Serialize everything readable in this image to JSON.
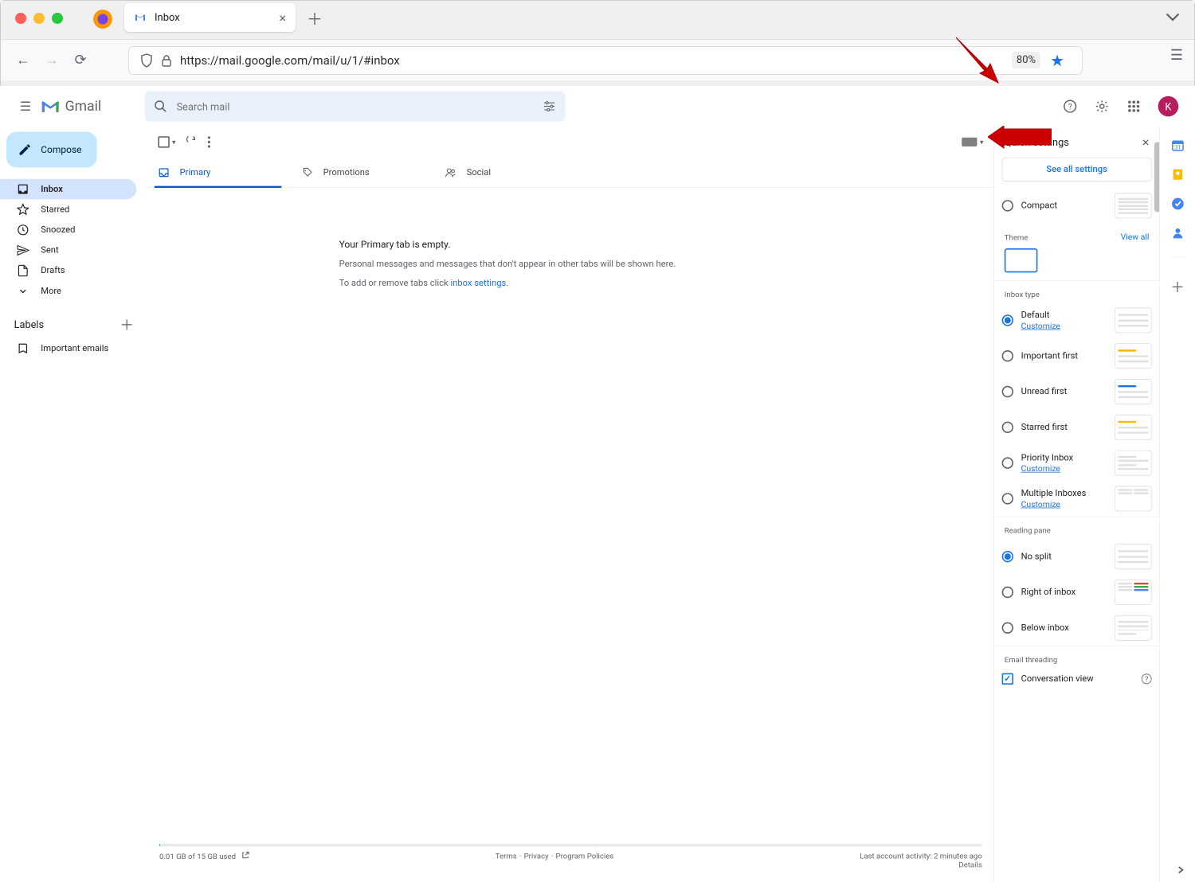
{
  "browser": {
    "tab_title": "Inbox",
    "url": "https://mail.google.com/mail/u/1/#inbox",
    "zoom": "80%"
  },
  "gmail": {
    "logo": "Gmail",
    "search_placeholder": "Search mail",
    "compose": "Compose",
    "avatar_initial": "K"
  },
  "nav": {
    "items": [
      {
        "label": "Inbox"
      },
      {
        "label": "Starred"
      },
      {
        "label": "Snoozed"
      },
      {
        "label": "Sent"
      },
      {
        "label": "Drafts"
      },
      {
        "label": "More"
      }
    ],
    "labels_header": "Labels",
    "labels": [
      {
        "label": "Important emails"
      }
    ]
  },
  "tabs": {
    "primary": "Primary",
    "promotions": "Promotions",
    "social": "Social"
  },
  "empty": {
    "title": "Your Primary tab is empty.",
    "line1": "Personal messages and messages that don't appear in other tabs will be shown here.",
    "line2_prefix": "To add or remove tabs click ",
    "line2_link": "inbox settings",
    "line2_suffix": "."
  },
  "footer": {
    "storage": "0.01 GB of 15 GB used",
    "terms": "Terms",
    "privacy": "Privacy",
    "policies": "Program Policies",
    "activity": "Last account activity: 2 minutes ago",
    "details": "Details"
  },
  "quick_settings": {
    "title": "Quick settings",
    "see_all": "See all settings",
    "density_compact": "Compact",
    "theme_hdr": "Theme",
    "view_all": "View all",
    "inbox_type_hdr": "Inbox type",
    "inbox_types": {
      "default": "Default",
      "customize": "Customize",
      "important_first": "Important first",
      "unread_first": "Unread first",
      "starred_first": "Starred first",
      "priority": "Priority Inbox",
      "multiple": "Multiple Inboxes"
    },
    "reading_pane_hdr": "Reading pane",
    "reading_pane": {
      "no_split": "No split",
      "right": "Right of inbox",
      "below": "Below inbox"
    },
    "threading_hdr": "Email threading",
    "conversation_view": "Conversation view"
  }
}
